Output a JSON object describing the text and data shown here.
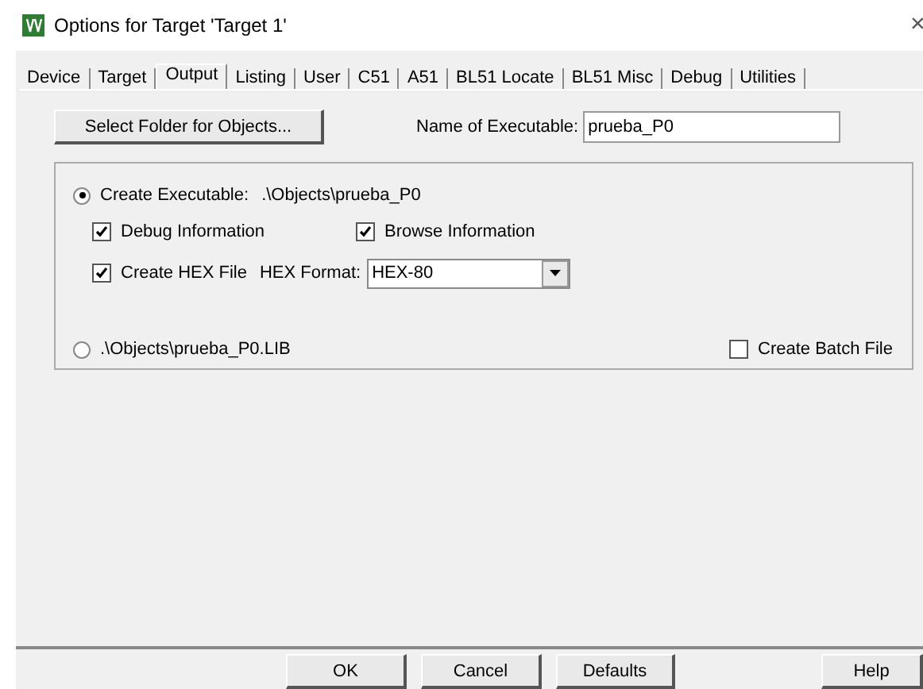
{
  "window": {
    "title": "Options for Target 'Target 1'",
    "close": "×"
  },
  "tabs": [
    {
      "label": "Device",
      "selected": false
    },
    {
      "label": "Target",
      "selected": false
    },
    {
      "label": "Output",
      "selected": true
    },
    {
      "label": "Listing",
      "selected": false
    },
    {
      "label": "User",
      "selected": false
    },
    {
      "label": "C51",
      "selected": false
    },
    {
      "label": "A51",
      "selected": false
    },
    {
      "label": "BL51 Locate",
      "selected": false
    },
    {
      "label": "BL51 Misc",
      "selected": false
    },
    {
      "label": "Debug",
      "selected": false
    },
    {
      "label": "Utilities",
      "selected": false
    }
  ],
  "select_folder_button": "Select Folder for Objects...",
  "name_of_executable": {
    "label": "Name of Executable:",
    "value": "prueba_P0"
  },
  "create_executable": {
    "label": "Create Executable:",
    "path": ".\\Objects\\prueba_P0",
    "selected": true
  },
  "debug_information": {
    "label": "Debug Information",
    "checked": true
  },
  "browse_information": {
    "label": "Browse Information",
    "checked": true
  },
  "create_hex_file": {
    "label": "Create HEX File",
    "checked": true
  },
  "hex_format": {
    "label": "HEX Format:",
    "value": "HEX-80"
  },
  "create_library": {
    "label": ".\\Objects\\prueba_P0.LIB",
    "selected": false
  },
  "create_batch_file": {
    "label": "Create Batch File",
    "checked": false
  },
  "buttons": [
    "OK",
    "Cancel",
    "Defaults",
    "Help"
  ]
}
